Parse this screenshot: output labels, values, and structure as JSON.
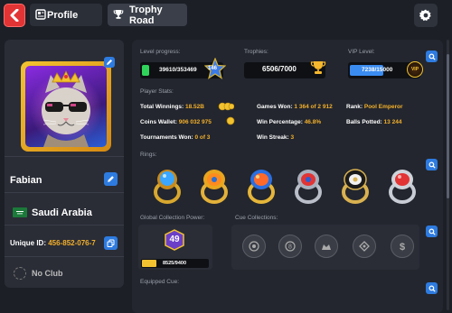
{
  "header": {
    "tabs": [
      {
        "label": "Profile",
        "active": false
      },
      {
        "label": "Trophy Road",
        "active": true
      }
    ]
  },
  "profile": {
    "name": "Fabian",
    "country": "Saudi Arabia",
    "unique_id_label": "Unique ID:",
    "unique_id": "456-852-076-7",
    "club": "No Club"
  },
  "level": {
    "label": "Level progress:",
    "text": "39610/353469",
    "progress": 0.112,
    "level": "146"
  },
  "trophies": {
    "label": "Trophies:",
    "text": "6506/7000"
  },
  "vip": {
    "label": "VIP Level:",
    "text": "7238/15000",
    "progress": 0.4825,
    "badge": "VIP"
  },
  "stats": {
    "label": "Player Stats:",
    "total_winnings_label": "Total Winnings:",
    "total_winnings": "18.52B",
    "games_won_label": "Games Won:",
    "games_won": "1 364 of 2 912",
    "rank_label": "Rank:",
    "rank": "Pool Emperor",
    "coins_wallet_label": "Coins Wallet:",
    "coins_wallet": "906 032 975",
    "win_percentage_label": "Win Percentage:",
    "win_percentage": "46.8%",
    "balls_potted_label": "Balls Potted:",
    "balls_potted": "13 244",
    "tournaments_won_label": "Tournaments Won:",
    "tournaments_won": "0 of 3",
    "win_streak_label": "Win Streak:",
    "win_streak": "3"
  },
  "rings": {
    "label": "Rings:",
    "items": [
      "ring-1",
      "ring-2",
      "ring-3",
      "ring-4",
      "ring-5",
      "ring-6"
    ]
  },
  "collection": {
    "label": "Global Collection Power:",
    "level": "49",
    "text": "8525/9400",
    "progress": 0.907
  },
  "cue_collections": {
    "label": "Cue Collections:"
  },
  "equipped_cue": {
    "label": "Equipped Cue:"
  },
  "colors": {
    "accent_red": "#e23434",
    "accent_blue": "#2e7be0",
    "gold": "#f3b02b",
    "green": "#2fd35a"
  }
}
